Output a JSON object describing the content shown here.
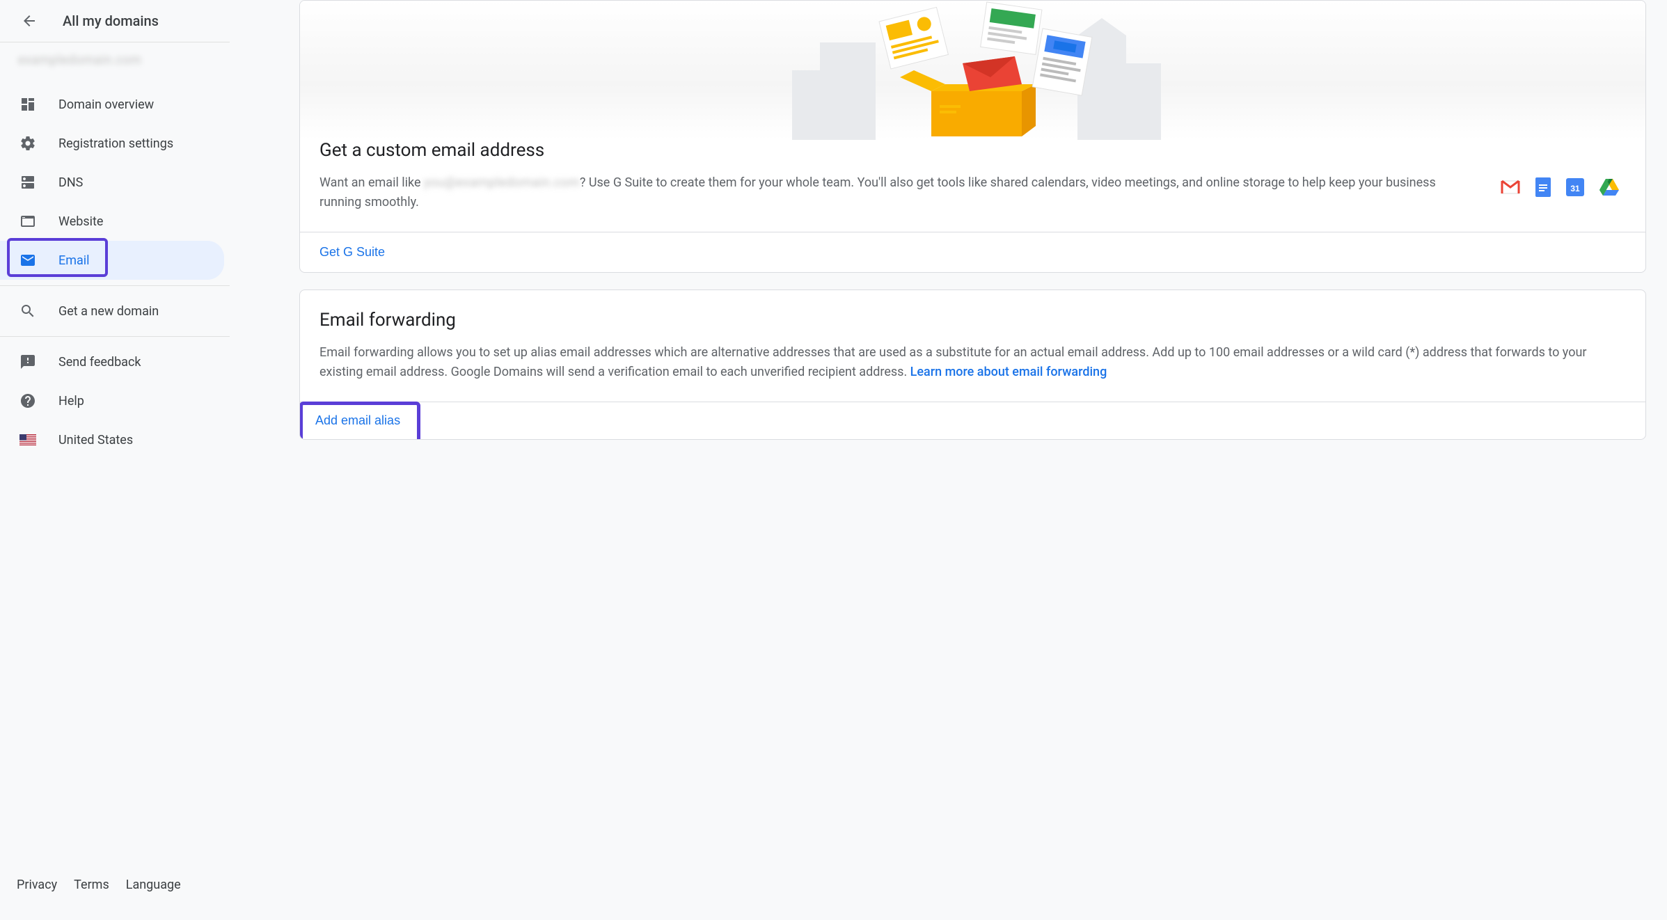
{
  "sidebar": {
    "title": "All my domains",
    "domain_blurred": "exampledomain.com",
    "nav": [
      {
        "label": "Domain overview"
      },
      {
        "label": "Registration settings"
      },
      {
        "label": "DNS"
      },
      {
        "label": "Website"
      },
      {
        "label": "Email"
      },
      {
        "label": "Get a new domain"
      },
      {
        "label": "Send feedback"
      },
      {
        "label": "Help"
      },
      {
        "label": "United States"
      }
    ]
  },
  "footer": {
    "privacy": "Privacy",
    "terms": "Terms",
    "language": "Language"
  },
  "gsuite_card": {
    "title": "Get a custom email address",
    "desc_prefix": "Want an email like ",
    "desc_blurred": "you@exampledomain.com",
    "desc_suffix": "? Use G Suite to create them for your whole team. You'll also get tools like shared calendars, video meetings, and online storage to help keep your business running smoothly.",
    "cta": "Get G Suite"
  },
  "forwarding_card": {
    "title": "Email forwarding",
    "desc": "Email forwarding allows you to set up alias email addresses which are alternative addresses that are used as a substitute for an actual email address. Add up to 100 email addresses or a wild card (*) address that forwards to your existing email address. Google Domains will send a verification email to each unverified recipient address. ",
    "learn_more": "Learn more about email forwarding",
    "add_alias": "Add email alias"
  }
}
